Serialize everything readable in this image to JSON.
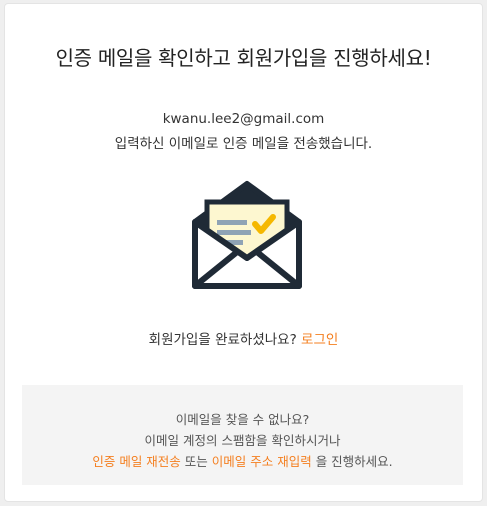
{
  "title": "인증 메일을 확인하고 회원가입을 진행하세요!",
  "email": "kwanu.lee2@gmail.com",
  "sent_message": "입력하신 이메일로 인증 메일을 전송했습니다.",
  "envelope_icon": "mail-envelope-icon",
  "login_prompt": {
    "text": "회원가입을 완료하셨나요? ",
    "link": "로그인"
  },
  "help": {
    "line1": "이메일을 찾을 수 없나요?",
    "line2": "이메일 계정의 스팸함을 확인하시거나",
    "resend_link": "인증 메일 재전송",
    "middle": " 또는 ",
    "reenter_link": "이메일 주소 재입력",
    "tail": " 을 진행하세요."
  },
  "colors": {
    "accent": "#f47f20",
    "envelope_dark": "#1f2a36",
    "paper": "#fdf7d0",
    "check": "#f5b800"
  }
}
